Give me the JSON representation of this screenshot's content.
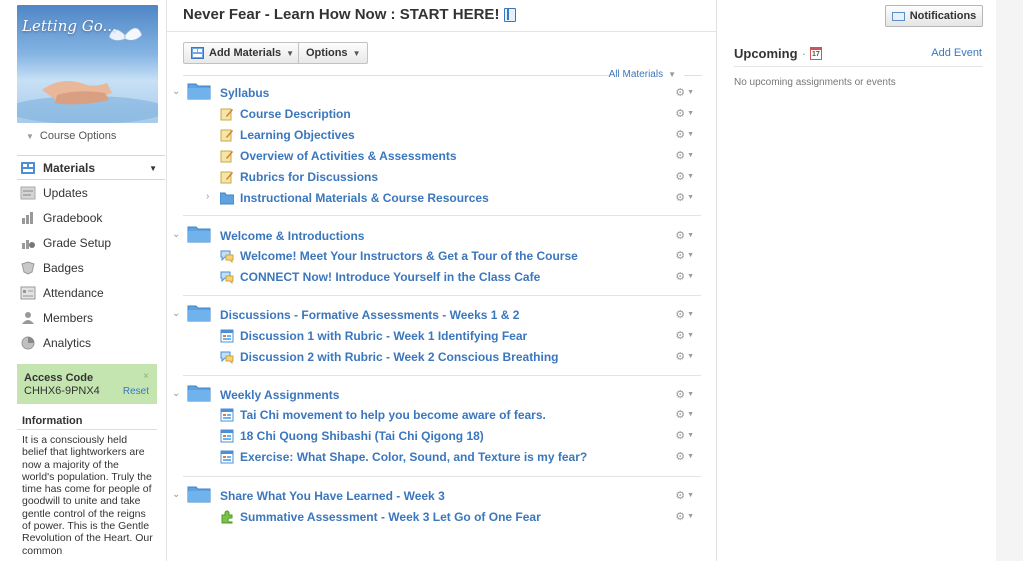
{
  "sidebar": {
    "profile_title": "Letting Go...",
    "course_options": "Course Options",
    "nav": [
      {
        "label": "Materials",
        "icon": "materials-icon",
        "active": true
      },
      {
        "label": "Updates",
        "icon": "updates-icon"
      },
      {
        "label": "Gradebook",
        "icon": "gradebook-icon"
      },
      {
        "label": "Grade Setup",
        "icon": "grade-setup-icon"
      },
      {
        "label": "Badges",
        "icon": "badges-icon"
      },
      {
        "label": "Attendance",
        "icon": "attendance-icon"
      },
      {
        "label": "Members",
        "icon": "members-icon"
      },
      {
        "label": "Analytics",
        "icon": "analytics-icon"
      }
    ],
    "access_code": {
      "title": "Access Code",
      "code": "CHHX6-9PNX4",
      "reset": "Reset",
      "close": "×"
    },
    "information": {
      "title": "Information",
      "text": "It is a consciously held belief that lightworkers are now a majority of the world's population. Truly the time has come for people of goodwill to unite and take gentle control of the reigns of power. This is the Gentle Revolution of the Heart. Our common"
    }
  },
  "main": {
    "title": "Never Fear - Learn How Now : START HERE!",
    "add_materials": "Add Materials",
    "options": "Options",
    "all_materials": "All Materials",
    "folders": [
      {
        "title": "Syllabus",
        "items": [
          {
            "label": "Course Description",
            "icon": "page-icon"
          },
          {
            "label": "Learning Objectives",
            "icon": "page-icon"
          },
          {
            "label": "Overview of Activities & Assessments",
            "icon": "page-icon"
          },
          {
            "label": "Rubrics for Discussions",
            "icon": "page-icon"
          },
          {
            "label": "Instructional Materials & Course Resources",
            "icon": "folder-icon",
            "collapsed": true
          }
        ]
      },
      {
        "title": "Welcome & Introductions",
        "items": [
          {
            "label": "Welcome! Meet Your Instructors & Get a Tour of the Course",
            "icon": "discussion-icon"
          },
          {
            "label": "CONNECT Now! Introduce Yourself in the Class Cafe",
            "icon": "discussion-icon"
          }
        ]
      },
      {
        "title": "Discussions - Formative Assessments - Weeks 1 & 2",
        "items": [
          {
            "label": "Discussion 1 with Rubric - Week 1 Identifying Fear",
            "icon": "assignment-icon"
          },
          {
            "label": "Discussion 2 with Rubric - Week 2 Conscious Breathing",
            "icon": "discussion-icon"
          }
        ]
      },
      {
        "title": "Weekly Assignments",
        "items": [
          {
            "label": "Tai Chi movement to help you become aware of fears.",
            "icon": "assignment-icon"
          },
          {
            "label": "18 Chi Quong Shibashi (Tai Chi Qigong 18)",
            "icon": "assignment-icon"
          },
          {
            "label": "Exercise: What Shape. Color, Sound, and Texture is my fear?",
            "icon": "assignment-icon"
          }
        ]
      },
      {
        "title": "Share What You Have Learned - Week 3",
        "items": [
          {
            "label": "Summative Assessment - Week 3 Let Go of One Fear",
            "icon": "assessment-icon"
          }
        ]
      }
    ]
  },
  "right": {
    "notifications": "Notifications",
    "upcoming": "Upcoming",
    "calendar_day": "17",
    "add_event": "Add Event",
    "empty": "No upcoming assignments or events"
  },
  "colors": {
    "link": "#3b77bd",
    "access_code_bg": "#c4e5b0",
    "folder": "#5ea3e0"
  }
}
